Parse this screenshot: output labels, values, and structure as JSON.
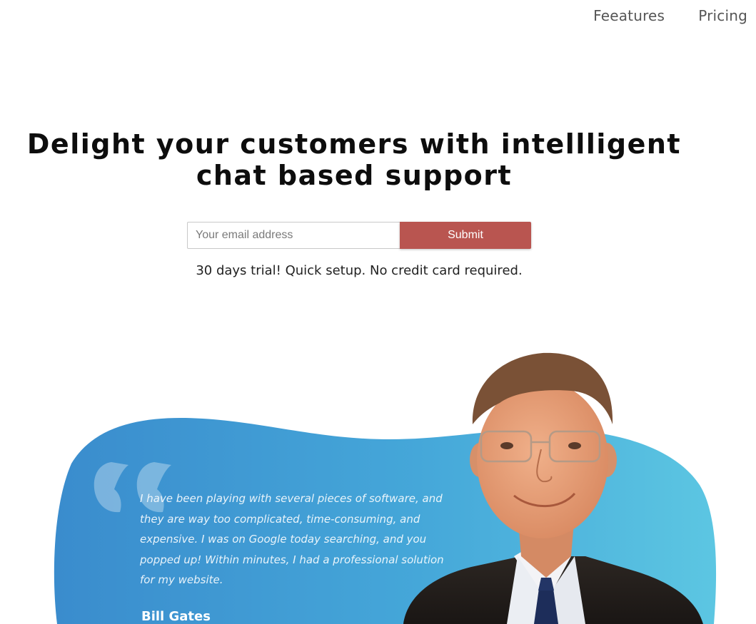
{
  "nav": {
    "items": [
      {
        "label": "Feeatures"
      },
      {
        "label": "Pricing"
      }
    ]
  },
  "hero": {
    "title_line1": "Delight your customers with intellligent",
    "title_line2": "chat based support"
  },
  "signup": {
    "email_placeholder": "Your email address",
    "submit_label": "Submit",
    "note": "30 days trial! Quick setup. No credit card required."
  },
  "testimonial": {
    "quote": "I have been playing with several pieces of software, and they are way too complicated, time-consuming, and expensive. I was on Google today searching, and you popped up! Within minutes, I had a professional solution for my website.",
    "author": "Bill Gates"
  },
  "colors": {
    "submit_bg": "#b95550",
    "blob_left": "#3a8fcf",
    "blob_right": "#55c2e0"
  }
}
